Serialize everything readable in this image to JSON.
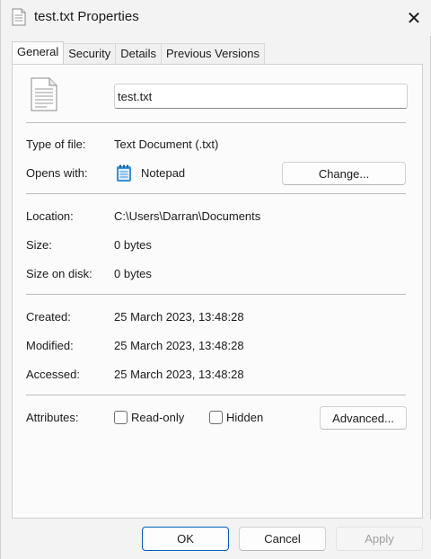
{
  "window": {
    "title": "test.txt Properties",
    "close_glyph": "✕"
  },
  "tabs": [
    {
      "label": "General",
      "active": true
    },
    {
      "label": "Security",
      "active": false
    },
    {
      "label": "Details",
      "active": false
    },
    {
      "label": "Previous Versions",
      "active": false
    }
  ],
  "general": {
    "file_icon": "text-document-icon",
    "file_name": "test.txt",
    "type_label": "Type of file:",
    "type_value": "Text Document (.txt)",
    "opens_label": "Opens with:",
    "opens_app": "Notepad",
    "opens_icon": "notepad-icon",
    "change_label": "Change...",
    "location_label": "Location:",
    "location_value": "C:\\Users\\Darran\\Documents",
    "size_label": "Size:",
    "size_value": "0 bytes",
    "size_disk_label": "Size on disk:",
    "size_disk_value": "0 bytes",
    "created_label": "Created:",
    "created_value": "25 March 2023, 13:48:28",
    "modified_label": "Modified:",
    "modified_value": "25 March 2023, 13:48:28",
    "accessed_label": "Accessed:",
    "accessed_value": "25 March 2023, 13:48:28",
    "attributes_label": "Attributes:",
    "readonly_label": "Read-only",
    "readonly_checked": false,
    "hidden_label": "Hidden",
    "hidden_checked": false,
    "advanced_label": "Advanced..."
  },
  "footer": {
    "ok_label": "OK",
    "cancel_label": "Cancel",
    "apply_label": "Apply"
  },
  "colors": {
    "accent": "#005fb8",
    "notepad": "#3a8fd6"
  }
}
